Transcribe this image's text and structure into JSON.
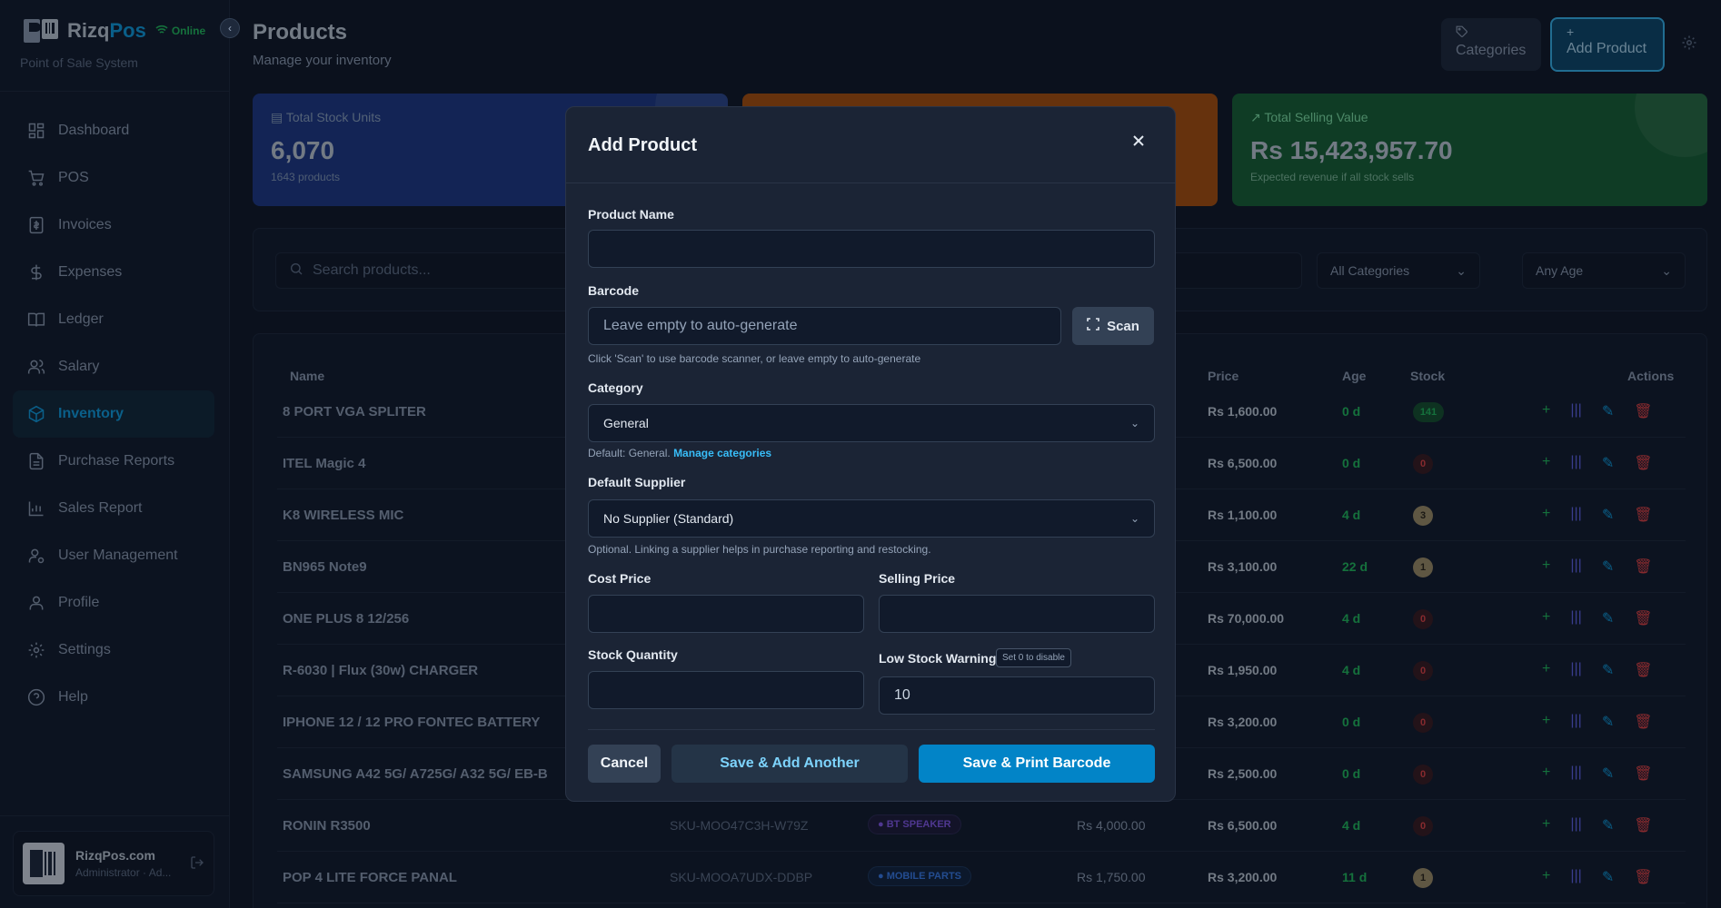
{
  "brand": {
    "name_part1": "Rizq",
    "name_part2": "Pos",
    "status": "Online",
    "subtitle": "Point of Sale System"
  },
  "sidebar": {
    "items": [
      {
        "label": "Dashboard",
        "icon": "dashboard-icon"
      },
      {
        "label": "POS",
        "icon": "cart-icon"
      },
      {
        "label": "Invoices",
        "icon": "invoice-icon"
      },
      {
        "label": "Expenses",
        "icon": "dollar-icon"
      },
      {
        "label": "Ledger",
        "icon": "book-icon"
      },
      {
        "label": "Salary",
        "icon": "users-icon"
      },
      {
        "label": "Inventory",
        "icon": "package-icon",
        "active": true
      },
      {
        "label": "Purchase Reports",
        "icon": "file-icon"
      },
      {
        "label": "Sales Report",
        "icon": "bar-chart-icon"
      },
      {
        "label": "User Management",
        "icon": "user-cog-icon"
      },
      {
        "label": "Profile",
        "icon": "user-icon"
      },
      {
        "label": "Settings",
        "icon": "gear-icon"
      },
      {
        "label": "Help",
        "icon": "help-icon"
      }
    ]
  },
  "user": {
    "name": "RizqPos.com",
    "role": "Administrator · Ad..."
  },
  "header": {
    "title": "Products",
    "subtitle": "Manage your inventory",
    "categories_btn": "Categories",
    "add_btn": "Add Product"
  },
  "stats": [
    {
      "label": "Total Stock Units",
      "value": "6,070",
      "note": "1643 products"
    },
    {
      "label": "",
      "value": "",
      "note": ""
    },
    {
      "label": "Total Selling Value",
      "value": "Rs 15,423,957.70",
      "note": "Expected revenue if all stock sells"
    }
  ],
  "filters": {
    "search_placeholder": "Search products...",
    "category": "All Categories",
    "age": "Any Age"
  },
  "table": {
    "headers": {
      "name": "Name",
      "price": "Price",
      "age": "Age",
      "stock": "Stock",
      "actions": "Actions"
    },
    "rows": [
      {
        "name": "8 PORT VGA SPLITER",
        "sku": "",
        "category": "",
        "cost": "",
        "price": "Rs 1,600.00",
        "age": "0 d",
        "stock": "141",
        "stock_level": "green"
      },
      {
        "name": "ITEL Magic 4",
        "sku": "",
        "category": "",
        "cost": "",
        "price": "Rs 6,500.00",
        "age": "0 d",
        "stock": "0",
        "stock_level": "red"
      },
      {
        "name": "K8 WIRELESS MIC",
        "sku": "",
        "category": "",
        "cost": "",
        "price": "Rs 1,100.00",
        "age": "4 d",
        "stock": "3",
        "stock_level": "amber"
      },
      {
        "name": "BN965 Note9",
        "sku": "",
        "category": "",
        "cost": "",
        "price": "Rs 3,100.00",
        "age": "22 d",
        "stock": "1",
        "stock_level": "amber"
      },
      {
        "name": "ONE PLUS 8 12/256",
        "sku": "",
        "category": "",
        "cost": "",
        "price": "Rs 70,000.00",
        "age": "4 d",
        "stock": "0",
        "stock_level": "red"
      },
      {
        "name": "R-6030 | Flux (30w) CHARGER",
        "sku": "",
        "category": "",
        "cost": "",
        "price": "Rs 1,950.00",
        "age": "4 d",
        "stock": "0",
        "stock_level": "red"
      },
      {
        "name": "IPHONE 12 / 12 PRO FONTEC BATTERY",
        "sku": "",
        "category": "",
        "cost": "",
        "price": "Rs 3,200.00",
        "age": "0 d",
        "stock": "0",
        "stock_level": "red"
      },
      {
        "name": "SAMSUNG A42 5G/ A725G/ A32 5G/ EB-B",
        "sku": "",
        "category": "",
        "cost": "",
        "price": "Rs 2,500.00",
        "age": "0 d",
        "stock": "0",
        "stock_level": "red"
      },
      {
        "name": "RONIN R3500",
        "sku": "SKU-MOO47C3H-W79Z",
        "category": "BT SPEAKER",
        "cat_color": "purple",
        "cost": "Rs 4,000.00",
        "price": "Rs 6,500.00",
        "age": "4 d",
        "stock": "0",
        "stock_level": "red"
      },
      {
        "name": "POP 4 LITE FORCE PANAL",
        "sku": "SKU-MOOA7UDX-DDBP",
        "category": "MOBILE PARTS",
        "cat_color": "blue",
        "cost": "Rs 1,750.00",
        "price": "Rs 3,200.00",
        "age": "11 d",
        "stock": "1",
        "stock_level": "amber"
      }
    ]
  },
  "modal": {
    "title": "Add Product",
    "product_name_label": "Product Name",
    "product_name_value": "",
    "barcode_label": "Barcode",
    "barcode_placeholder": "Leave empty to auto-generate",
    "scan_label": "Scan",
    "barcode_hint": "Click 'Scan' to use barcode scanner, or leave empty to auto-generate",
    "category_label": "Category",
    "category_value": "General",
    "category_hint": "Default: General.",
    "manage_categories": "Manage categories",
    "supplier_label": "Default Supplier",
    "supplier_value": "No Supplier (Standard)",
    "supplier_hint": "Optional. Linking a supplier helps in purchase reporting and restocking.",
    "cost_label": "Cost Price",
    "selling_label": "Selling Price",
    "stock_label": "Stock Quantity",
    "low_stock_label": "Low Stock Warning",
    "low_stock_tag": "Set 0 to disable",
    "low_stock_value": "10",
    "cancel": "Cancel",
    "save_another": "Save & Add Another",
    "save_print": "Save & Print Barcode"
  }
}
